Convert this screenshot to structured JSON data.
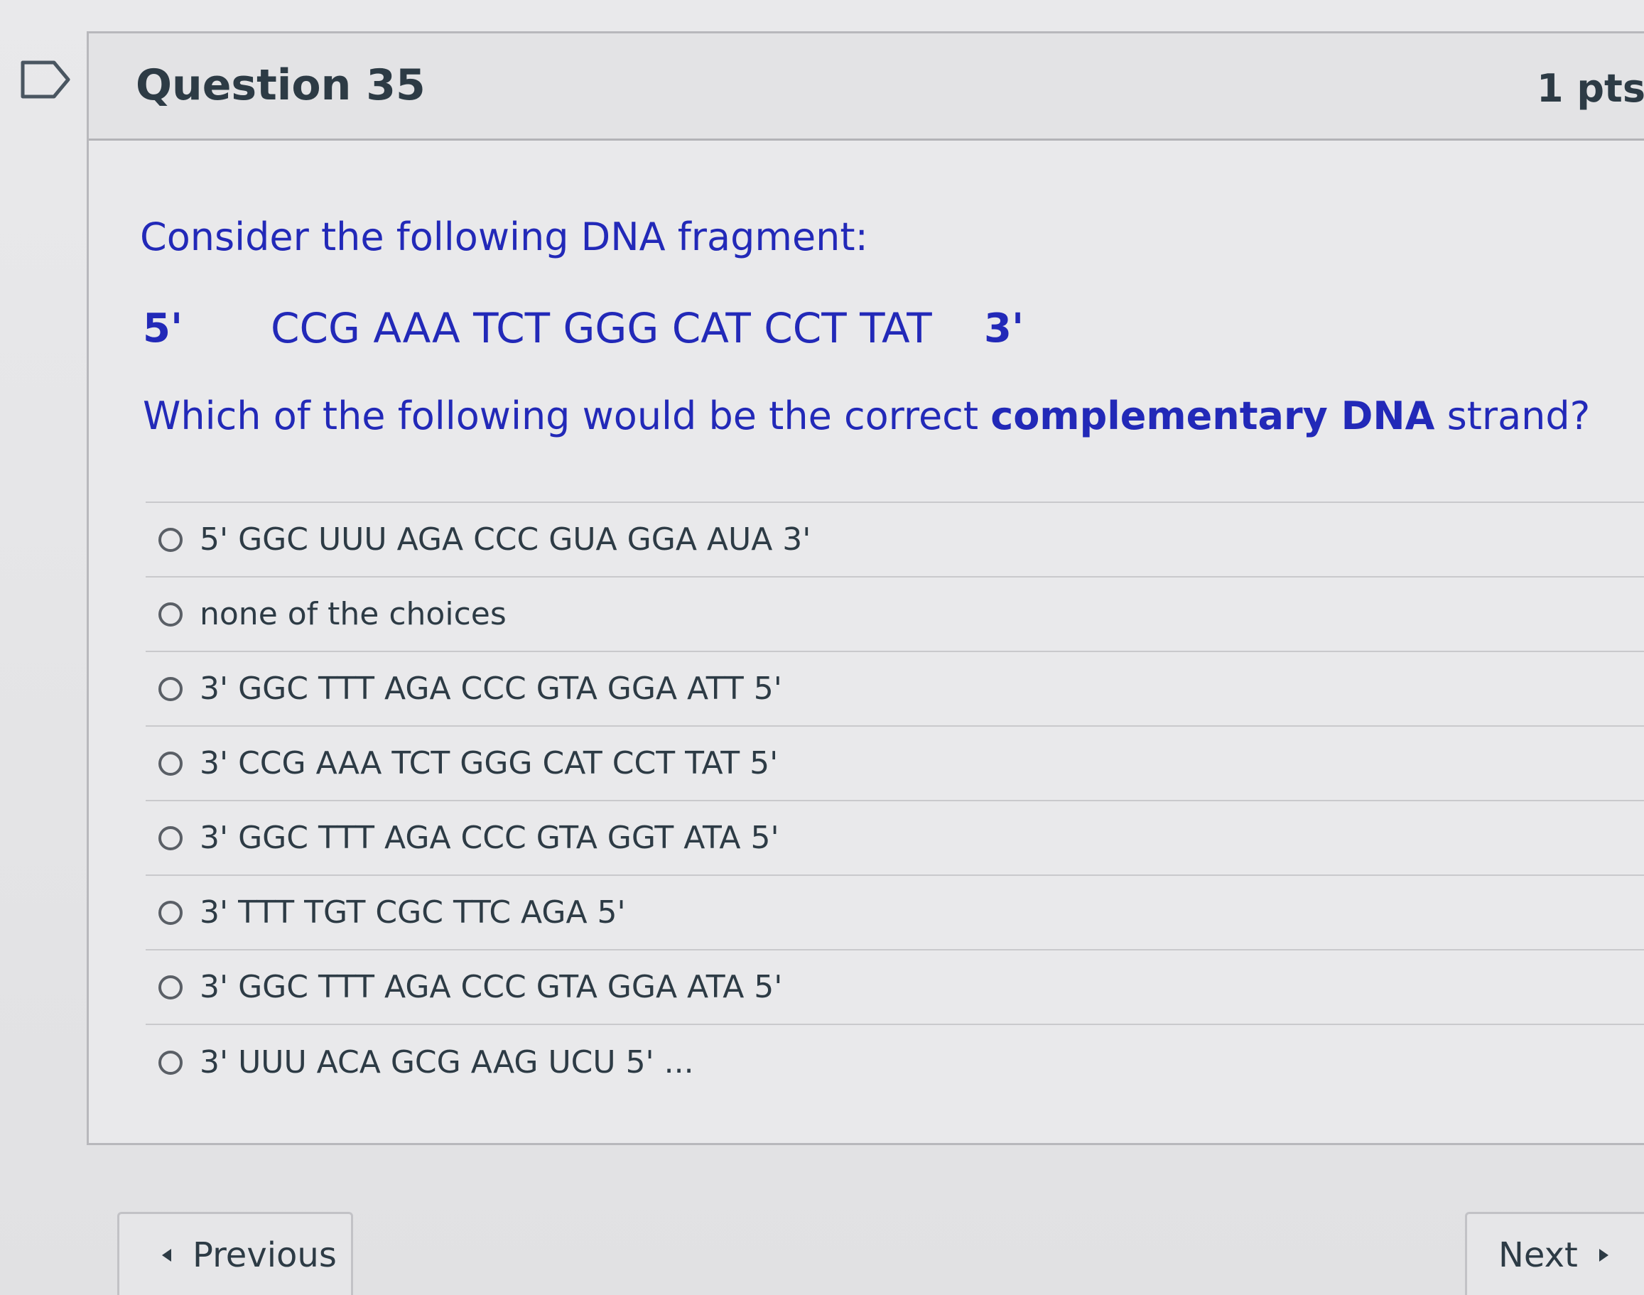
{
  "question": {
    "title": "Question 35",
    "points": "1 pts",
    "intro": "Consider the following DNA fragment:",
    "fragment": {
      "five_prime": "5'",
      "sequence": "CCG AAA TCT GGG CAT CCT TAT",
      "three_prime": "3'"
    },
    "prompt_start": "Which of the following would be the correct ",
    "prompt_bold": "complementary DNA",
    "prompt_end": " strand?",
    "answers": [
      "5' GGC UUU AGA CCC GUA GGA AUA 3'",
      "none of the choices",
      "3' GGC TTT AGA CCC GTA GGA ATT 5'",
      "3' CCG AAA TCT GGG CAT CCT TAT 5'",
      "3' GGC TTT AGA CCC GTA GGT ATA 5'",
      "3' TTT TGT CGC TTC AGA 5'",
      "3' GGC TTT AGA CCC GTA GGA ATA 5'",
      "3' UUU ACA GCG AAG UCU 5' ..."
    ]
  },
  "navigation": {
    "previous_label": "Previous",
    "next_label": "Next"
  },
  "icons": {
    "flag": "flag-icon",
    "previous": "caret-left-icon",
    "next": "caret-right-icon"
  },
  "colors": {
    "question_text": "#2229b8",
    "body_text": "#2d3b45",
    "border": "#b8b8bc"
  }
}
